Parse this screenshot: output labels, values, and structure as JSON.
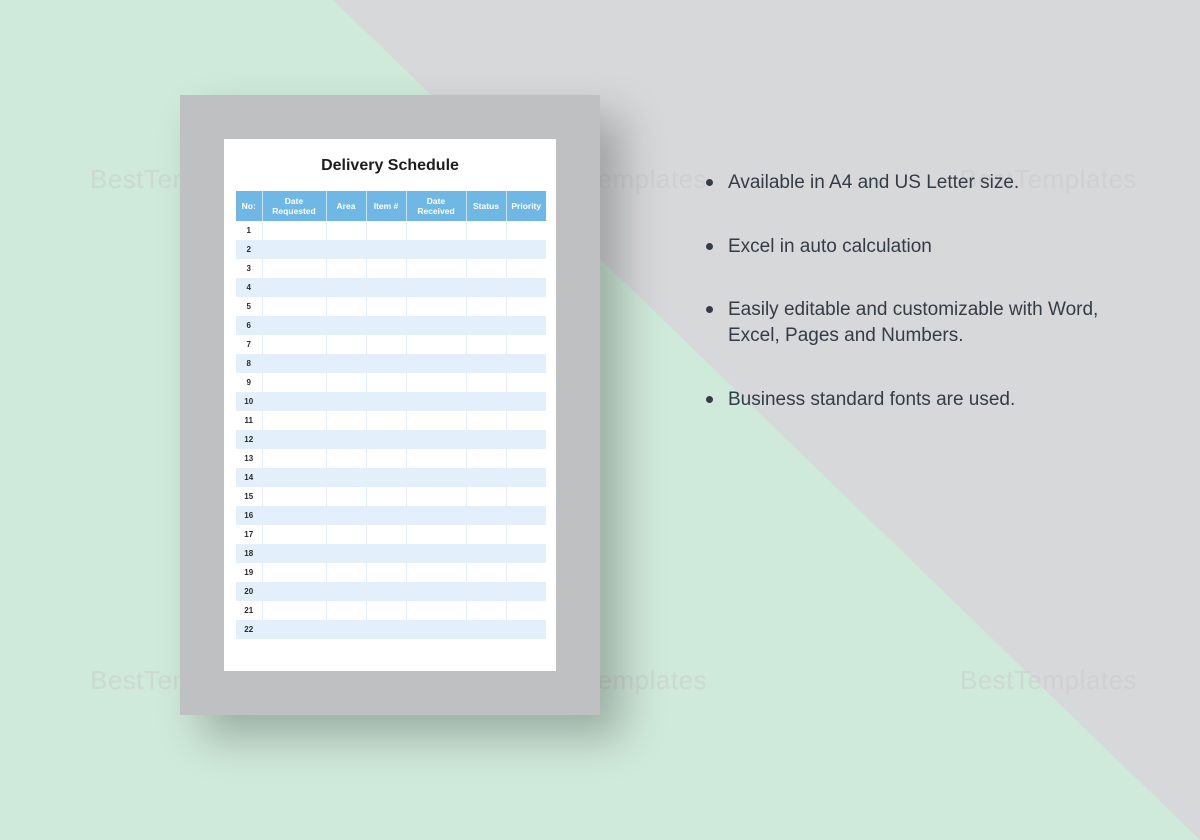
{
  "watermark_text": "BestTemplates",
  "document": {
    "title": "Delivery Schedule",
    "columns": [
      "No:",
      "Date Requested",
      "Area",
      "Item #",
      "Date Received",
      "Status",
      "Priority"
    ],
    "row_count": 22
  },
  "features": [
    "Available in A4 and US Letter size.",
    "Excel in auto calculation",
    "Easily editable and customizable with Word, Excel, Pages and Numbers.",
    "Business standard fonts are used."
  ]
}
